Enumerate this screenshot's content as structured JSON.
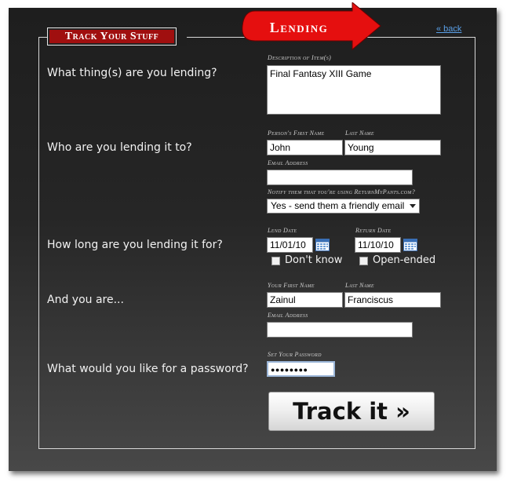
{
  "header": {
    "badge": "Track Your Stuff",
    "banner": "Lending",
    "back_link": "« back"
  },
  "colors": {
    "accent_red": "#a00f0f",
    "arrow_red": "#e50f0f",
    "link_blue": "#5aa0e8"
  },
  "sections": {
    "item": {
      "question": "What thing(s) are you lending?",
      "description_label": "Description of Item(s)",
      "description_value": "Final Fantasy XIII Game"
    },
    "borrower": {
      "question": "Who are you lending it to?",
      "first_name_label": "Person's First Name",
      "first_name_value": "John",
      "last_name_label": "Last Name",
      "last_name_value": "Young",
      "email_label": "Email Address",
      "email_value": "",
      "notify_label": "Notify them that you're using ReturnMyPants.com?",
      "notify_value": "Yes - send them a friendly email"
    },
    "duration": {
      "question": "How long are you lending it for?",
      "lend_date_label": "Lend Date",
      "lend_date_value": "11/01/10",
      "return_date_label": "Return Date",
      "return_date_value": "11/10/10",
      "dont_know_label": "Don't know",
      "open_ended_label": "Open-ended"
    },
    "you": {
      "question": "And you are...",
      "first_name_label": "Your First Name",
      "first_name_value": "Zainul",
      "last_name_label": "Last Name",
      "last_name_value": "Franciscus",
      "email_label": "Email Address",
      "email_value": ""
    },
    "password": {
      "question": "What would you like for a password?",
      "label": "Set Your Password",
      "value": "●●●●●●●●"
    }
  },
  "submit": {
    "label": "Track it »"
  },
  "icons": [
    "calendar-icon",
    "chevron-down-icon",
    "arrow-banner"
  ]
}
